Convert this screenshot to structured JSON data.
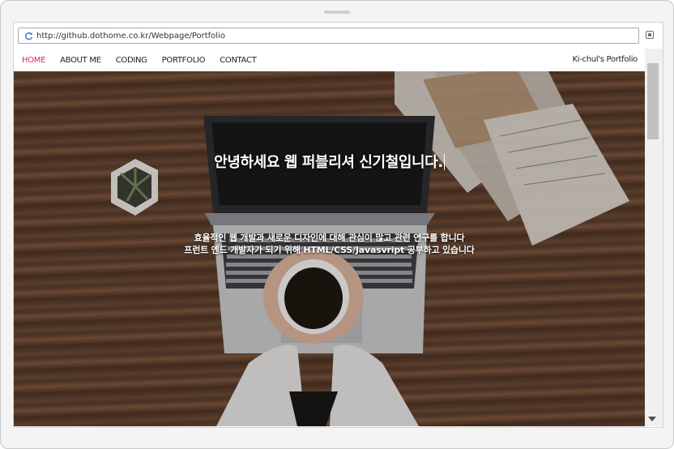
{
  "browser": {
    "url": "http://github.dothome.co.kr/Webpage/Portfolio"
  },
  "nav": {
    "items": [
      {
        "label": "HOME",
        "active": true
      },
      {
        "label": "ABOUT ME",
        "active": false
      },
      {
        "label": "CODING",
        "active": false
      },
      {
        "label": "PORTFOLIO",
        "active": false
      },
      {
        "label": "CONTACT",
        "active": false
      }
    ],
    "brand": "Ki-chul's Portfolio",
    "active_color": "#e0257a"
  },
  "hero": {
    "title": "안녕하세요 웹 퍼블리셔 신기철입니다.",
    "desc_line1": "효율적인 웹 개발과 새로운 디자인에 대해 관심이 많고 관련 연구를 합니다",
    "desc_line2": "프런트 엔드 개발자가 되기 위해 HTML/CSS/Javasvript 공부하고 있습니다"
  },
  "icons": {
    "reload": "reload-icon",
    "menu": "menu-icon",
    "scroll_down": "scroll-down-arrow-icon"
  }
}
